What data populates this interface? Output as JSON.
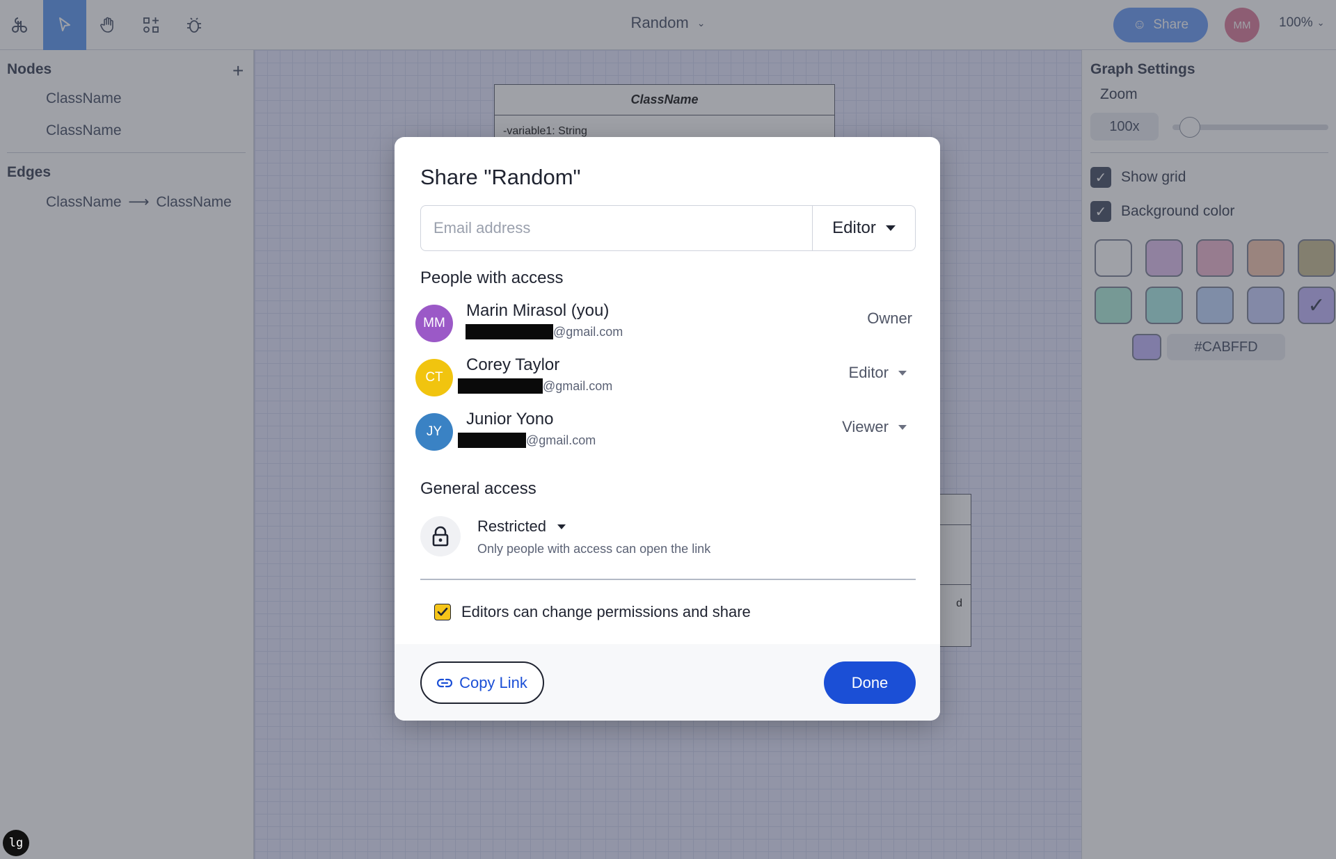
{
  "toolbar": {
    "document_title": "Random",
    "share_label": "Share",
    "user_initials": "MM",
    "zoom_label": "100%"
  },
  "left_panel": {
    "nodes_heading": "Nodes",
    "nodes": [
      "ClassName",
      "ClassName"
    ],
    "edges_heading": "Edges",
    "edges": [
      {
        "from": "ClassName",
        "arrow": "⟶",
        "to": "ClassName"
      }
    ]
  },
  "canvas": {
    "class_box_title": "ClassName",
    "class_box_attr": "-variable1: String",
    "second_box_row": "d"
  },
  "right_panel": {
    "heading": "Graph Settings",
    "zoom_label": "Zoom",
    "zoom_value": "100x",
    "zoom_slider_fraction": 0.05,
    "show_grid_label": "Show grid",
    "show_grid_checked": true,
    "background_color_label": "Background color",
    "background_color_checked": true,
    "swatches": [
      "#ffffff",
      "#e6c8f2",
      "#f2c0d6",
      "#f6cdb8",
      "#cfc59f",
      "#b8f2e0",
      "#b6f0ea",
      "#c9dcff",
      "#cfd6ff",
      "#CABFFD"
    ],
    "selected_swatch_index": 9,
    "hex_value": "#CABFFD"
  },
  "dialog": {
    "title": "Share \"Random\"",
    "email_placeholder": "Email address",
    "role_value": "Editor",
    "people_heading": "People with access",
    "people": [
      {
        "initials": "MM",
        "name": "Marin Mirasol (you)",
        "email_suffix": "@gmail.com",
        "role": "Owner",
        "avatar_color": "#9b59c7"
      },
      {
        "initials": "CT",
        "name": "Corey Taylor",
        "email_suffix": "@gmail.com",
        "role": "Editor",
        "avatar_color": "#f1c40f"
      },
      {
        "initials": "JY",
        "name": "Junior Yono",
        "email_suffix": "@gmail.com",
        "role": "Viewer",
        "avatar_color": "#3a82c4"
      }
    ],
    "general_access_heading": "General access",
    "access_level": "Restricted",
    "access_description": "Only people with access can open the link",
    "editors_permission_label": "Editors can change permissions and share",
    "editors_permission_checked": true,
    "copy_link_label": "Copy Link",
    "done_label": "Done"
  },
  "badge": "lg",
  "colors": {
    "primary": "#1b4fd6",
    "checkbox": "#f6c519"
  }
}
